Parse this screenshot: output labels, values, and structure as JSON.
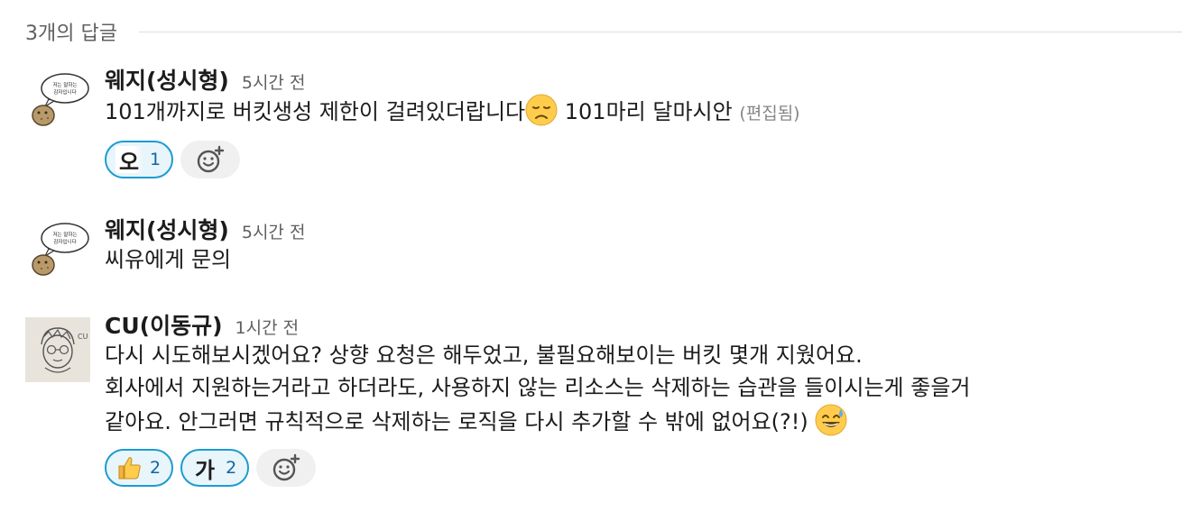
{
  "thread": {
    "replies_label": "3개의 답글"
  },
  "messages": [
    {
      "author": "웨지(성시형)",
      "time": "5시간 전",
      "text_part1": "101개까지로 버킷생성 제한이 걸려있더랍니다",
      "emoji_inline": "disappointed-face",
      "text_part2": " 101마리 달마시안 ",
      "edited_label": "(편집됨)",
      "avatar_text": [
        "저는 말하는",
        "감자입니다"
      ],
      "reactions": [
        {
          "emoji_text": "오",
          "count": "1"
        }
      ]
    },
    {
      "author": "웨지(성시형)",
      "time": "5시간 전",
      "text": "씨유에게 문의",
      "avatar_text": [
        "저는 말하는",
        "감자입니다"
      ]
    },
    {
      "author": "CU(이동규)",
      "time": "1시간 전",
      "lines": [
        "다시 시도해보시겠어요? 상향 요청은 해두었고, 불필요해보이는 버킷 몇개 지웠어요.",
        "회사에서 지원하는거라고 하더라도, 사용하지 않는 리소스는 삭제하는 습관을 들이시는게 좋을거",
        "같아요. 안그러면 규칙적으로 삭제하는 로직을 다시 추가할 수 밖에 없어요(?!) "
      ],
      "emoji_inline": "grinning-sweat-face",
      "avatar_text": [
        "CU"
      ],
      "reactions": [
        {
          "emoji": "thumbs-up",
          "count": "2"
        },
        {
          "emoji_text": "가",
          "count": "2"
        }
      ]
    }
  ],
  "colors": {
    "reaction_border": "#1d9bd1",
    "reaction_bg": "#e8f5fa",
    "reaction_count": "#1264a3",
    "muted_text": "#616061"
  }
}
